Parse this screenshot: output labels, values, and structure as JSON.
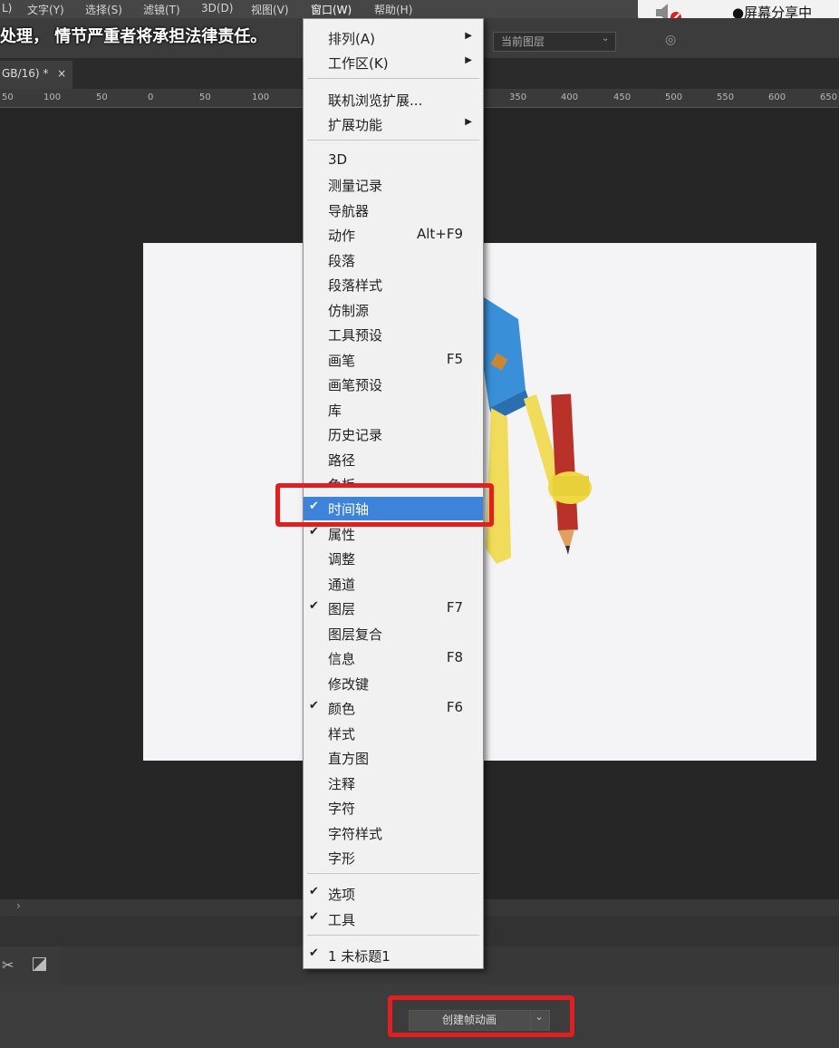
{
  "menubar": {
    "items": [
      "L)",
      "文字(Y)",
      "选择(S)",
      "滤镜(T)",
      "3D(D)",
      "视图(V)",
      "窗口(W)",
      "帮助(H)"
    ]
  },
  "share": {
    "text": "●屏幕分享中",
    "icon": "speaker-muted-icon"
  },
  "watermark": {
    "text": "处理， 情节严重者将承担法律责任。"
  },
  "options": {
    "layer_sample": "当前图层"
  },
  "document": {
    "tab_title": "GB/16) *",
    "close": "×"
  },
  "ruler": {
    "ticks": [
      "50",
      "100",
      "50",
      "0",
      "50",
      "100",
      "350",
      "400",
      "450",
      "500",
      "550",
      "600",
      "650"
    ]
  },
  "window_menu": {
    "top_items": [
      {
        "label": "排列(A)",
        "submenu": true
      },
      {
        "label": "工作区(K)",
        "submenu": true
      }
    ],
    "ext_items": [
      {
        "label": "联机浏览扩展...",
        "submenu": false
      },
      {
        "label": "扩展功能",
        "submenu": true
      }
    ],
    "panel_items": [
      {
        "label": "3D",
        "shortcut": "",
        "checked": false
      },
      {
        "label": "测量记录",
        "shortcut": "",
        "checked": false
      },
      {
        "label": "导航器",
        "shortcut": "",
        "checked": false
      },
      {
        "label": "动作",
        "shortcut": "Alt+F9",
        "checked": false
      },
      {
        "label": "段落",
        "shortcut": "",
        "checked": false
      },
      {
        "label": "段落样式",
        "shortcut": "",
        "checked": false
      },
      {
        "label": "仿制源",
        "shortcut": "",
        "checked": false
      },
      {
        "label": "工具预设",
        "shortcut": "",
        "checked": false
      },
      {
        "label": "画笔",
        "shortcut": "F5",
        "checked": false
      },
      {
        "label": "画笔预设",
        "shortcut": "",
        "checked": false
      },
      {
        "label": "库",
        "shortcut": "",
        "checked": false
      },
      {
        "label": "历史记录",
        "shortcut": "",
        "checked": false
      },
      {
        "label": "路径",
        "shortcut": "",
        "checked": false
      },
      {
        "label": "色板",
        "shortcut": "",
        "checked": false
      },
      {
        "label": "时间轴",
        "shortcut": "",
        "checked": true,
        "highlighted": true
      },
      {
        "label": "属性",
        "shortcut": "",
        "checked": true
      },
      {
        "label": "调整",
        "shortcut": "",
        "checked": false
      },
      {
        "label": "通道",
        "shortcut": "",
        "checked": false
      },
      {
        "label": "图层",
        "shortcut": "F7",
        "checked": true
      },
      {
        "label": "图层复合",
        "shortcut": "",
        "checked": false
      },
      {
        "label": "信息",
        "shortcut": "F8",
        "checked": false
      },
      {
        "label": "修改键",
        "shortcut": "",
        "checked": false
      },
      {
        "label": "颜色",
        "shortcut": "F6",
        "checked": true
      },
      {
        "label": "样式",
        "shortcut": "",
        "checked": false
      },
      {
        "label": "直方图",
        "shortcut": "",
        "checked": false
      },
      {
        "label": "注释",
        "shortcut": "",
        "checked": false
      },
      {
        "label": "字符",
        "shortcut": "",
        "checked": false
      },
      {
        "label": "字符样式",
        "shortcut": "",
        "checked": false
      },
      {
        "label": "字形",
        "shortcut": "",
        "checked": false
      }
    ],
    "ui_items": [
      {
        "label": "选项",
        "checked": true
      },
      {
        "label": "工具",
        "checked": true
      }
    ],
    "doc_items": [
      {
        "label": "1 未标题1",
        "checked": true
      }
    ]
  },
  "timeline": {
    "create_button": "创建帧动画",
    "dropdown_icon": "chevron-down-icon"
  },
  "colors": {
    "highlight": "#3c83d9",
    "annotation": "#e02020",
    "menu_bg": "#f1f1f1"
  }
}
